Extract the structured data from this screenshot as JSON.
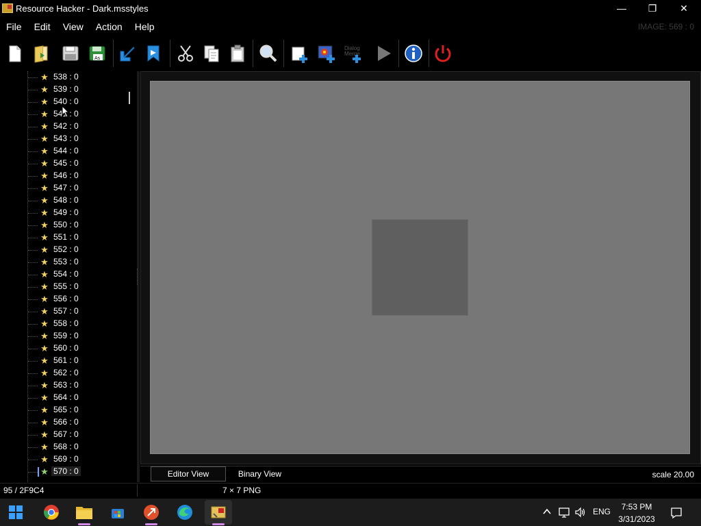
{
  "window": {
    "title": "Resource Hacker - Dark.msstyles",
    "min_glyph": "—",
    "max_glyph": "❐",
    "close_glyph": "✕"
  },
  "menu": {
    "items": [
      "File",
      "Edit",
      "View",
      "Action",
      "Help"
    ],
    "image_label": "IMAGE: 569 : 0"
  },
  "toolbar": {
    "icons": [
      "new-file-icon",
      "open-folder-icon",
      "save-icon",
      "save-as-icon",
      "compile-down-arrow-icon",
      "bookmark-arrow-icon",
      "cut-icon",
      "copy-icon",
      "paste-icon",
      "find-icon",
      "add-resource-icon",
      "add-image-icon",
      "add-dialog-icon",
      "run-script-icon",
      "info-icon",
      "exit-power-icon"
    ],
    "dialog_icon_text": "Dialog Merge"
  },
  "tree": {
    "items": [
      "538 : 0",
      "539 : 0",
      "540 : 0",
      "541 : 0",
      "542 : 0",
      "543 : 0",
      "544 : 0",
      "545 : 0",
      "546 : 0",
      "547 : 0",
      "548 : 0",
      "549 : 0",
      "550 : 0",
      "551 : 0",
      "552 : 0",
      "553 : 0",
      "554 : 0",
      "555 : 0",
      "556 : 0",
      "557 : 0",
      "558 : 0",
      "559 : 0",
      "560 : 0",
      "561 : 0",
      "562 : 0",
      "563 : 0",
      "564 : 0",
      "565 : 0",
      "566 : 0",
      "567 : 0",
      "568 : 0",
      "569 : 0",
      "570 : 0"
    ],
    "selected": "570 : 0",
    "star_glyph": "★"
  },
  "editor": {
    "tabs": [
      "Editor View",
      "Binary View"
    ],
    "active_tab": "Editor View",
    "scale": "scale 20.00"
  },
  "status": {
    "left": "95 / 2F9C4",
    "mid": "7 × 7  PNG"
  },
  "taskbar": {
    "apps": [
      "start-icon",
      "chrome-icon",
      "file-explorer-icon",
      "store-icon",
      "remote-desktop-icon",
      "edge-icon",
      "resource-hacker-icon"
    ],
    "tray_language": "ENG",
    "clock_time": "7:53 PM",
    "clock_date": "3/31/2023"
  }
}
